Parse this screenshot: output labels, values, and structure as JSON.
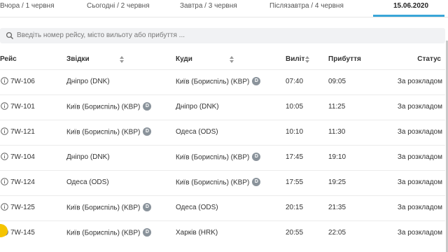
{
  "date_tabs": [
    "Вчора / 1 червня",
    "Сьогодні / 2 червня",
    "Завтра / 3 червня",
    "Післязавтра / 4 червня",
    "15.06.2020"
  ],
  "search": {
    "placeholder": "Введіть номер рейсу, місто вильоту або прибуття ..."
  },
  "columns": {
    "flight": "Рейс",
    "from": "Звідки",
    "to": "Куди",
    "departure": "Виліт",
    "arrival": "Прибуття",
    "status": "Статус"
  },
  "terminal_badge": "D",
  "flights": [
    {
      "flight": "7W-106",
      "from": "Дніпро (DNK)",
      "to": "Київ (Бориспіль) (KBP)",
      "dep": "07:40",
      "arr": "09:05",
      "status": "За розкладом"
    },
    {
      "flight": "7W-101",
      "from": "Київ (Бориспіль) (KBP)",
      "to": "Дніпро (DNK)",
      "dep": "10:05",
      "arr": "11:25",
      "status": "За розкладом"
    },
    {
      "flight": "7W-121",
      "from": "Київ (Бориспіль) (KBP)",
      "to": "Одеса (ODS)",
      "dep": "10:10",
      "arr": "11:30",
      "status": "За розкладом"
    },
    {
      "flight": "7W-104",
      "from": "Дніпро (DNK)",
      "to": "Київ (Бориспіль) (KBP)",
      "dep": "17:45",
      "arr": "19:10",
      "status": "За розкладом"
    },
    {
      "flight": "7W-124",
      "from": "Одеса (ODS)",
      "to": "Київ (Бориспіль) (KBP)",
      "dep": "17:55",
      "arr": "19:25",
      "status": "За розкладом"
    },
    {
      "flight": "7W-125",
      "from": "Київ (Бориспіль) (KBP)",
      "to": "Одеса (ODS)",
      "dep": "20:15",
      "arr": "21:35",
      "status": "За розкладом"
    },
    {
      "flight": "7W-145",
      "from": "Київ (Бориспіль) (KBP)",
      "to": "Харків (HRK)",
      "dep": "20:55",
      "arr": "22:05",
      "status": "За розкладом"
    }
  ],
  "colors": {
    "accent": "#3aa6d8",
    "badge": "#8a939b",
    "search_bg": "#f1f2f4",
    "assistant": "#f5c400"
  }
}
